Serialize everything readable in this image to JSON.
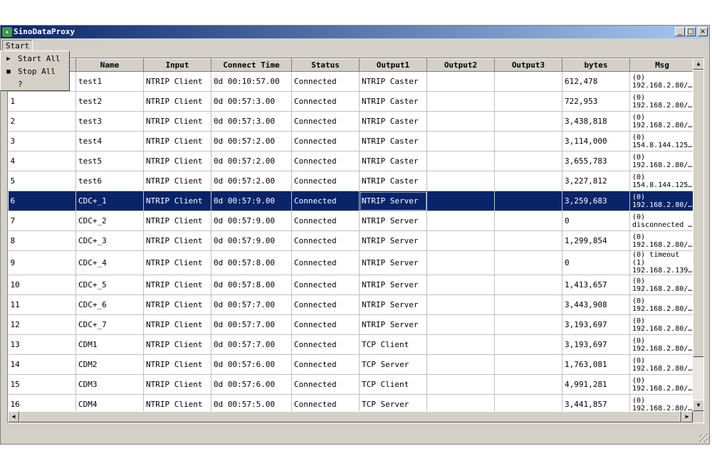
{
  "window": {
    "title": "SinoDataProxy",
    "icon": "app-icon"
  },
  "menubar": {
    "start_label": "Start"
  },
  "dropdown": {
    "items": [
      {
        "icon": "play-icon",
        "label": "Start All"
      },
      {
        "icon": "stop-icon",
        "label": "Stop All"
      },
      {
        "icon": "",
        "label": "?"
      }
    ]
  },
  "table": {
    "headers": [
      "",
      "Name",
      "Input",
      "Connect Time",
      "Status",
      "Output1",
      "Output2",
      "Output3",
      "bytes",
      "Msg"
    ],
    "selected_row": 6,
    "rows": [
      {
        "id": "",
        "name": "test1",
        "input": "NTRIP Client",
        "time": "0d 00:10:57.00",
        "status": "Connected",
        "out1": "NTRIP Caster",
        "out2": "",
        "out3": "",
        "bytes": "612,478",
        "msg1": "(0)",
        "msg2": "192.168.2.80/…"
      },
      {
        "id": "1",
        "name": "test2",
        "input": "NTRIP Client",
        "time": "0d 00:57:3.00",
        "status": "Connected",
        "out1": "NTRIP Caster",
        "out2": "",
        "out3": "",
        "bytes": "722,953",
        "msg1": "(0)",
        "msg2": "192.168.2.80/…"
      },
      {
        "id": "2",
        "name": "test3",
        "input": "NTRIP Client",
        "time": "0d 00:57:3.00",
        "status": "Connected",
        "out1": "NTRIP Caster",
        "out2": "",
        "out3": "",
        "bytes": "3,438,818",
        "msg1": "(0)",
        "msg2": "192.168.2.80/…"
      },
      {
        "id": "3",
        "name": "test4",
        "input": "NTRIP Client",
        "time": "0d 00:57:2.00",
        "status": "Connected",
        "out1": "NTRIP Caster",
        "out2": "",
        "out3": "",
        "bytes": "3,114,000",
        "msg1": "(0)",
        "msg2": "154.8.144.125…"
      },
      {
        "id": "4",
        "name": "test5",
        "input": "NTRIP Client",
        "time": "0d 00:57:2.00",
        "status": "Connected",
        "out1": "NTRIP Caster",
        "out2": "",
        "out3": "",
        "bytes": "3,655,783",
        "msg1": "(0)",
        "msg2": "192.168.2.80/…"
      },
      {
        "id": "5",
        "name": "test6",
        "input": "NTRIP Client",
        "time": "0d 00:57:2.00",
        "status": "Connected",
        "out1": "NTRIP Caster",
        "out2": "",
        "out3": "",
        "bytes": "3,227,812",
        "msg1": "(0)",
        "msg2": "154.8.144.125…"
      },
      {
        "id": "6",
        "name": "CDC+_1",
        "input": "NTRIP Client",
        "time": "0d 00:57:9.00",
        "status": "Connected",
        "out1": "NTRIP Server",
        "out2": "",
        "out3": "",
        "bytes": "3,259,683",
        "msg1": "(0)",
        "msg2": "192.168.2.80/…"
      },
      {
        "id": "7",
        "name": "CDC+_2",
        "input": "NTRIP Client",
        "time": "0d 00:57:9.00",
        "status": "Connected",
        "out1": "NTRIP Server",
        "out2": "",
        "out3": "",
        "bytes": "0",
        "msg1": "(0)",
        "msg2": "disconnected …"
      },
      {
        "id": "8",
        "name": "CDC+_3",
        "input": "NTRIP Client",
        "time": "0d 00:57:9.00",
        "status": "Connected",
        "out1": "NTRIP Server",
        "out2": "",
        "out3": "",
        "bytes": "1,299,854",
        "msg1": "(0)",
        "msg2": "192.168.2.80/…"
      },
      {
        "id": "9",
        "name": "CDC+_4",
        "input": "NTRIP Client",
        "time": "0d 00:57:8.00",
        "status": "Connected",
        "out1": "NTRIP Server",
        "out2": "",
        "out3": "",
        "bytes": "0",
        "msg1": "(0) timeout (1)",
        "msg2": "192.168.2.139…"
      },
      {
        "id": "10",
        "name": "CDC+_5",
        "input": "NTRIP Client",
        "time": "0d 00:57:8.00",
        "status": "Connected",
        "out1": "NTRIP Server",
        "out2": "",
        "out3": "",
        "bytes": "1,413,657",
        "msg1": "(0)",
        "msg2": "192.168.2.80/…"
      },
      {
        "id": "11",
        "name": "CDC+_6",
        "input": "NTRIP Client",
        "time": "0d 00:57:7.00",
        "status": "Connected",
        "out1": "NTRIP Server",
        "out2": "",
        "out3": "",
        "bytes": "3,443,908",
        "msg1": "(0)",
        "msg2": "192.168.2.80/…"
      },
      {
        "id": "12",
        "name": "CDC+_7",
        "input": "NTRIP Client",
        "time": "0d 00:57:7.00",
        "status": "Connected",
        "out1": "NTRIP Server",
        "out2": "",
        "out3": "",
        "bytes": "3,193,697",
        "msg1": "(0)",
        "msg2": "192.168.2.80/…"
      },
      {
        "id": "13",
        "name": "CDM1",
        "input": "NTRIP Client",
        "time": "0d 00:57:7.00",
        "status": "Connected",
        "out1": "TCP Client",
        "out2": "",
        "out3": "",
        "bytes": "3,193,697",
        "msg1": "(0)",
        "msg2": "192.168.2.80/…"
      },
      {
        "id": "14",
        "name": "CDM2",
        "input": "NTRIP Client",
        "time": "0d 00:57:6.00",
        "status": "Connected",
        "out1": "TCP Server",
        "out2": "",
        "out3": "",
        "bytes": "1,763,081",
        "msg1": "(0)",
        "msg2": "192.168.2.80/…"
      },
      {
        "id": "15",
        "name": "CDM3",
        "input": "NTRIP Client",
        "time": "0d 00:57:6.00",
        "status": "Connected",
        "out1": "TCP Client",
        "out2": "",
        "out3": "",
        "bytes": "4,991,281",
        "msg1": "(0)",
        "msg2": "192.168.2.80/…"
      },
      {
        "id": "16",
        "name": "CDM4",
        "input": "NTRIP Client",
        "time": "0d 00:57:5.00",
        "status": "Connected",
        "out1": "TCP Server",
        "out2": "",
        "out3": "",
        "bytes": "3,441,857",
        "msg1": "(0)",
        "msg2": "192.168.2.80/…"
      }
    ]
  }
}
